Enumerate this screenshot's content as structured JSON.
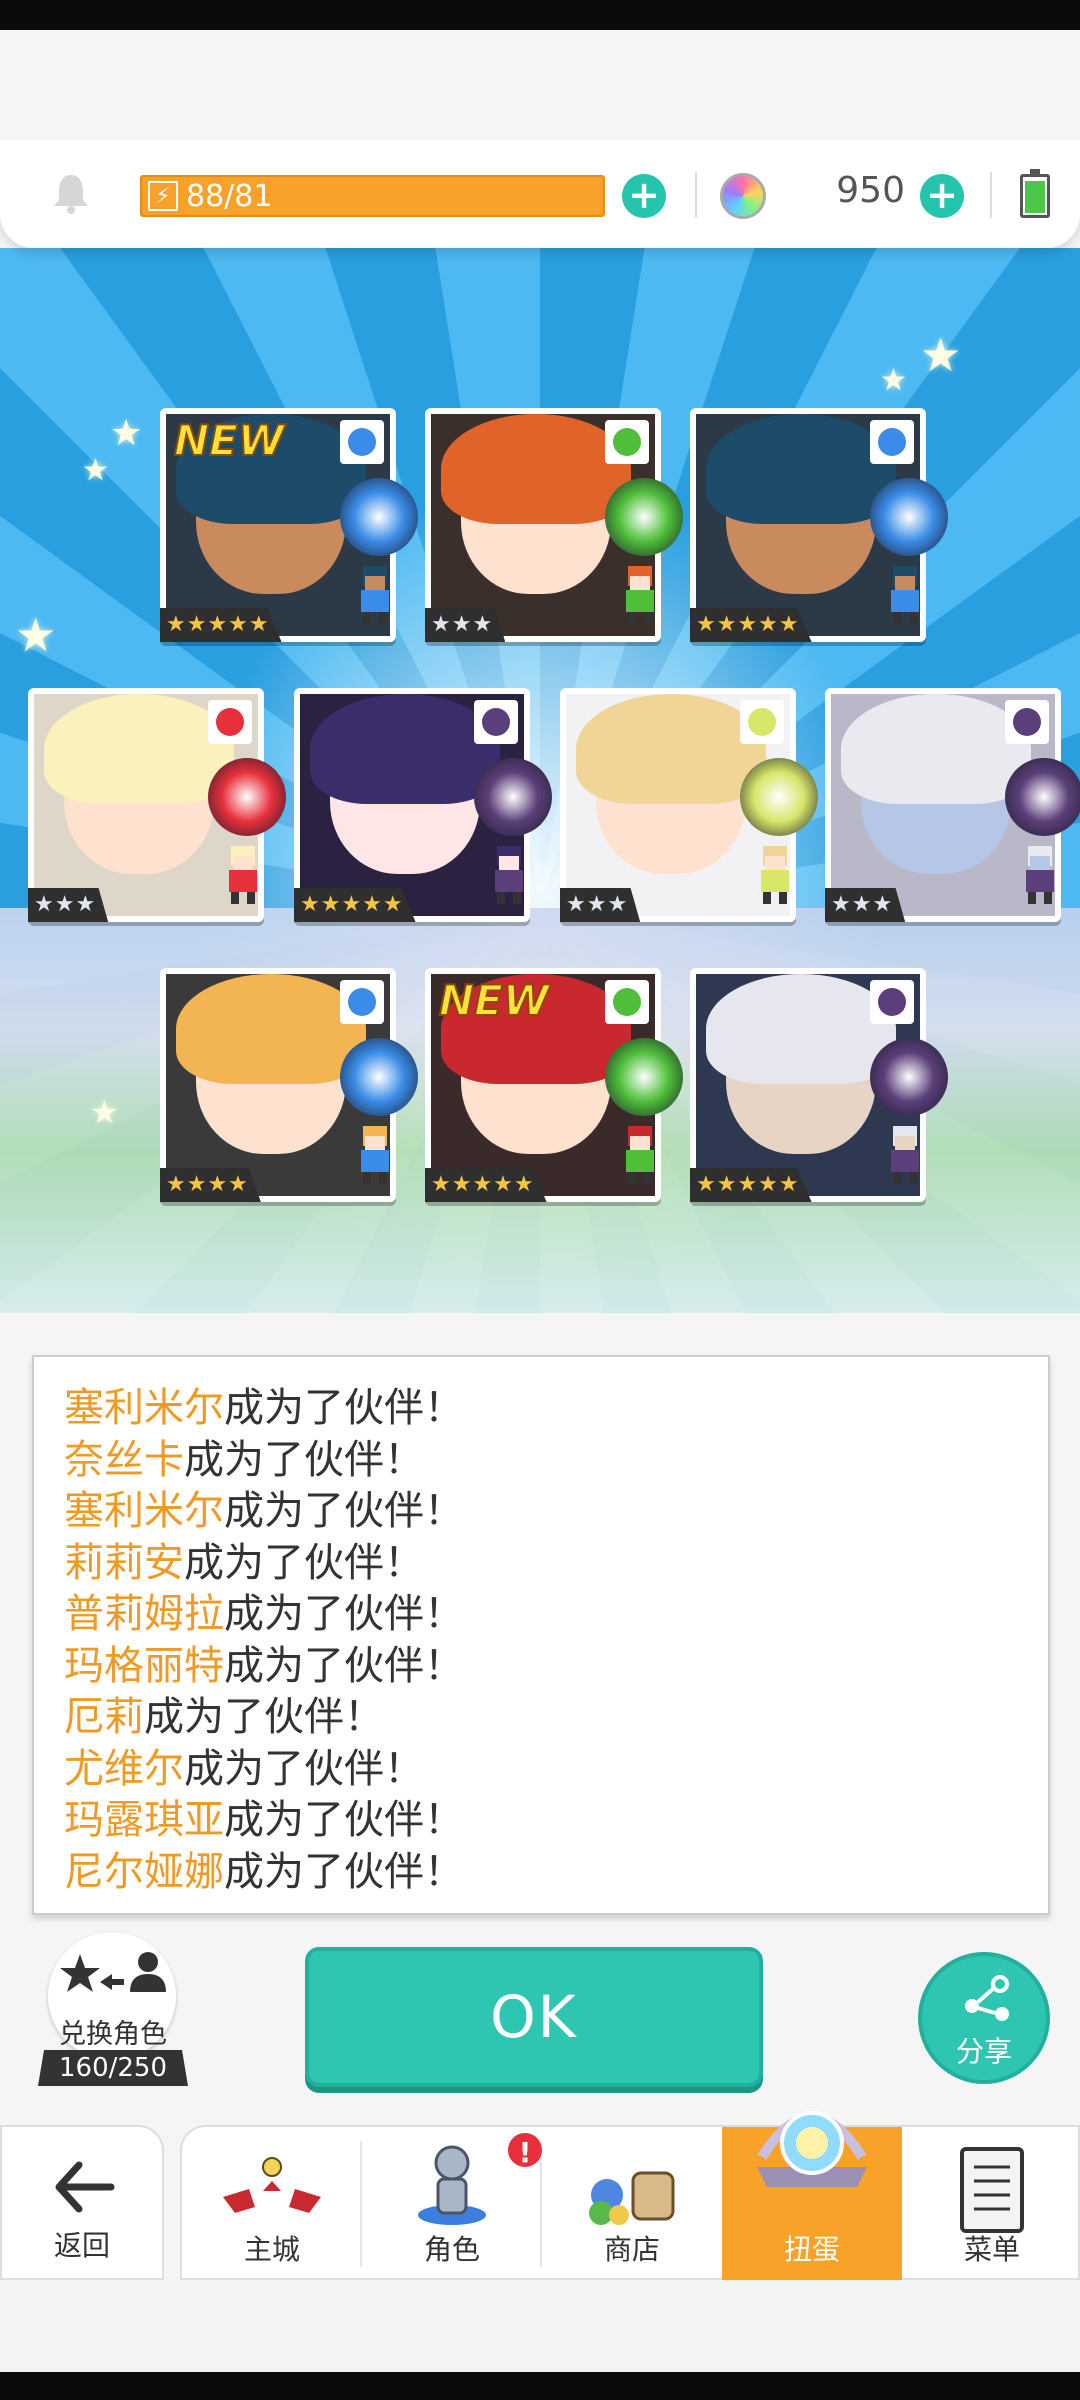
{
  "header": {
    "energy_text": "88/81",
    "energy_level": 1.0,
    "gems": "950",
    "battery_level": 0.85,
    "icons": [
      "bell-icon",
      "lightning-icon",
      "plus-icon",
      "rainbow-gem-icon",
      "battery-icon"
    ]
  },
  "summon": {
    "cards": [
      {
        "name": "塞利米尔",
        "rarity": 5,
        "element": "water",
        "new": true,
        "new_label": "NEW"
      },
      {
        "name": "奈丝卡",
        "rarity": 3,
        "element": "earth",
        "new": false
      },
      {
        "name": "塞利米尔",
        "rarity": 5,
        "element": "water",
        "new": false
      },
      {
        "name": "莉莉安",
        "rarity": 3,
        "element": "fire",
        "new": false
      },
      {
        "name": "普莉姆拉",
        "rarity": 5,
        "element": "dark",
        "new": false
      },
      {
        "name": "玛格丽特",
        "rarity": 3,
        "element": "light",
        "new": false
      },
      {
        "name": "厄莉",
        "rarity": 3,
        "element": "dark",
        "new": false
      },
      {
        "name": "尤维尔",
        "rarity": 4,
        "element": "water",
        "new": false
      },
      {
        "name": "玛露琪亚",
        "rarity": 5,
        "element": "earth",
        "new": true,
        "new_label": "NEW"
      },
      {
        "name": "尼尔娅娜",
        "rarity": 5,
        "element": "dark",
        "new": false
      }
    ],
    "colors": {
      "water": "#3a8ce8",
      "earth": "#4fbf3a",
      "fire": "#e8303c",
      "dark": "#5b3f7a",
      "light": "#d8e66a"
    }
  },
  "messages": {
    "suffix": "成为了伙伴！",
    "names": [
      "塞利米尔",
      "奈丝卡",
      "塞利米尔",
      "莉莉安",
      "普莉姆拉",
      "玛格丽特",
      "厄莉",
      "尤维尔",
      "玛露琪亚",
      "尼尔娅娜"
    ]
  },
  "exchange": {
    "label": "兑换角色",
    "count": "160/250"
  },
  "ok_label": "OK",
  "share_label": "分享",
  "nav": {
    "back": "返回",
    "tabs": [
      "主城",
      "角色",
      "商店",
      "扭蛋",
      "菜单"
    ],
    "active": "扭蛋",
    "badge": "!"
  }
}
